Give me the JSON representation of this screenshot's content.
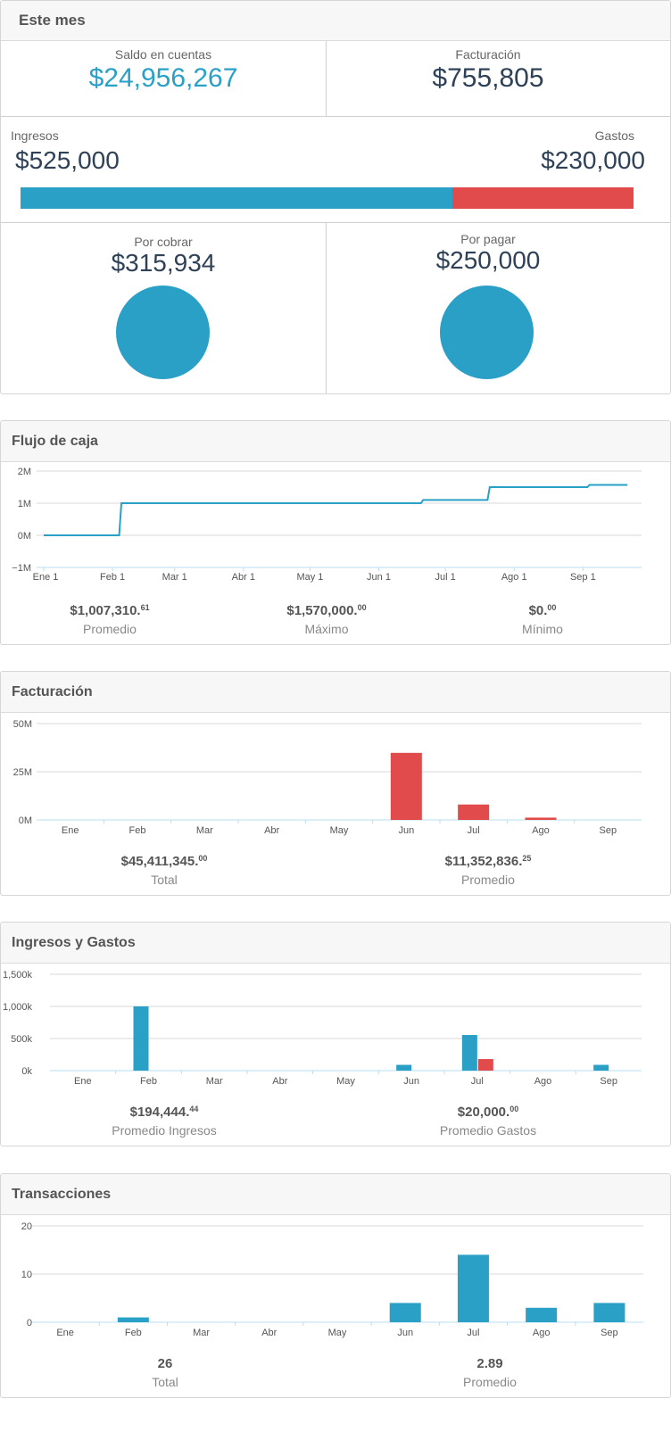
{
  "colors": {
    "blue": "#2aa0c7",
    "red": "#e14b4b",
    "dark": "#2f4157",
    "grid": "#d8d8d8"
  },
  "summary": {
    "title": "Este mes",
    "saldo_label": "Saldo en cuentas",
    "saldo_value": "$24,956,267",
    "facturacion_label": "Facturación",
    "facturacion_value": "$755,805",
    "ingresos_label": "Ingresos",
    "ingresos_value": "$525,000",
    "gastos_label": "Gastos",
    "gastos_value": "$230,000",
    "ingresos_fraction": 0.705,
    "cobrar_label": "Por cobrar",
    "cobrar_value": "$315,934",
    "pagar_label": "Por pagar",
    "pagar_value": "$250,000"
  },
  "flujo": {
    "title": "Flujo de caja",
    "stats": [
      {
        "int": "$1,007,310.",
        "dec": "61",
        "label": "Promedio"
      },
      {
        "int": "$1,570,000.",
        "dec": "00",
        "label": "Máximo"
      },
      {
        "int": "$0.",
        "dec": "00",
        "label": "Mínimo"
      }
    ]
  },
  "facturacion": {
    "title": "Facturación",
    "stats": [
      {
        "int": "$45,411,345.",
        "dec": "00",
        "label": "Total"
      },
      {
        "int": "$11,352,836.",
        "dec": "25",
        "label": "Promedio"
      }
    ]
  },
  "ingresos_gastos": {
    "title": "Ingresos y Gastos",
    "stats": [
      {
        "int": "$194,444.",
        "dec": "44",
        "label": "Promedio Ingresos"
      },
      {
        "int": "$20,000.",
        "dec": "00",
        "label": "Promedio Gastos"
      }
    ]
  },
  "transacciones": {
    "title": "Transacciones",
    "stats": [
      {
        "int": "26",
        "dec": "",
        "label": "Total"
      },
      {
        "int": "2.89",
        "dec": "",
        "label": "Promedio"
      }
    ]
  },
  "chart_data": [
    {
      "type": "line",
      "x_ticks": [
        "Ene 1",
        "Feb 1",
        "Mar 1",
        "Abr 1",
        "May 1",
        "Jun 1",
        "Jul 1",
        "Ago 1",
        "Sep 1"
      ],
      "y_ticks": [
        "2M",
        "1M",
        "0M",
        "−1M"
      ],
      "ylim": [
        -1000000,
        2000000
      ],
      "x": [
        "2015-01-01",
        "2015-02-04",
        "2015-02-05",
        "2015-06-20",
        "2015-06-21",
        "2015-07-20",
        "2015-07-21",
        "2015-09-03",
        "2015-09-04",
        "2015-09-21"
      ],
      "values": [
        0,
        0,
        1000000,
        1000000,
        1100000,
        1100000,
        1500000,
        1500000,
        1570000,
        1570000
      ]
    },
    {
      "type": "bar",
      "categories": [
        "Ene",
        "Feb",
        "Mar",
        "Abr",
        "May",
        "Jun",
        "Jul",
        "Ago",
        "Sep"
      ],
      "y_ticks": [
        "50M",
        "25M",
        "0M"
      ],
      "ylim": [
        0,
        50000000
      ],
      "series": [
        {
          "values": [
            0,
            0,
            0,
            0,
            0,
            34800000,
            8000000,
            1200000,
            0
          ],
          "color": "#e14b4b"
        }
      ]
    },
    {
      "type": "bar",
      "categories": [
        "Ene",
        "Feb",
        "Mar",
        "Abr",
        "May",
        "Jun",
        "Jul",
        "Ago",
        "Sep"
      ],
      "y_ticks": [
        "1,500k",
        "1,000k",
        "500k",
        "0k"
      ],
      "ylim": [
        0,
        1500000
      ],
      "series": [
        {
          "values": [
            0,
            1000000,
            0,
            0,
            0,
            90000,
            555000,
            0,
            90000
          ],
          "color": "#2aa0c7"
        },
        {
          "values": [
            0,
            0,
            0,
            0,
            0,
            0,
            180000,
            0,
            0
          ],
          "color": "#e14b4b"
        }
      ]
    },
    {
      "type": "bar",
      "categories": [
        "Ene",
        "Feb",
        "Mar",
        "Abr",
        "May",
        "Jun",
        "Jul",
        "Ago",
        "Sep"
      ],
      "y_ticks": [
        "20",
        "10",
        "0"
      ],
      "ylim": [
        0,
        20
      ],
      "series": [
        {
          "values": [
            0,
            1,
            0,
            0,
            0,
            4,
            14,
            3,
            4
          ],
          "color": "#2aa0c7"
        }
      ]
    }
  ]
}
